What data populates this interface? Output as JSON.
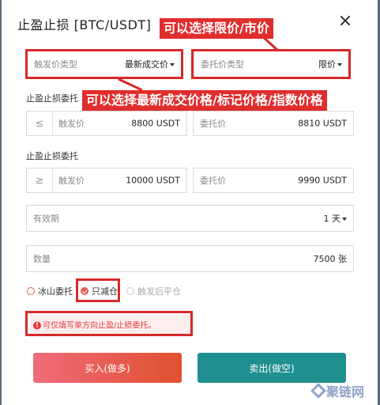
{
  "dialog": {
    "title": "止盈止损 [BTC/USDT]",
    "close_icon": "×"
  },
  "row1": {
    "trigger_type_label": "触发价类型",
    "trigger_type_value": "最新成交价",
    "order_type_label": "委托价类型",
    "order_type_value": "限价"
  },
  "take_profit": {
    "section_label": "止盈止损委托",
    "symbol": "≤",
    "trigger_label": "触发价",
    "trigger_value": "8800 USDT",
    "order_label": "委托价",
    "order_value": "8810 USDT"
  },
  "stop_loss": {
    "section_label": "止盈止损委托",
    "symbol": "≥",
    "trigger_label": "触发价",
    "trigger_value": "10000 USDT",
    "order_label": "委托价",
    "order_value": "9990 USDT"
  },
  "validity": {
    "label": "有效期",
    "value": "1 天"
  },
  "quantity": {
    "label": "数量",
    "value": "7500 张"
  },
  "options": {
    "iceberg": "冰山委托",
    "reduce_only": "只减仓",
    "close_after_trigger": "触发后平仓"
  },
  "notice": {
    "text": "可仅填写单方向止盈/止损委托。"
  },
  "buttons": {
    "buy": "买入(做多)",
    "sell": "卖出(做空)"
  },
  "annotations": {
    "order_type_callout": "可以选择限价/市价",
    "trigger_type_callout": "可以选择最新成交价格/标记价格/指数价格"
  },
  "watermark": "聚链网",
  "colors": {
    "buy": "#e8604b",
    "sell": "#1f8f8f",
    "accent": "#e02d2d"
  }
}
